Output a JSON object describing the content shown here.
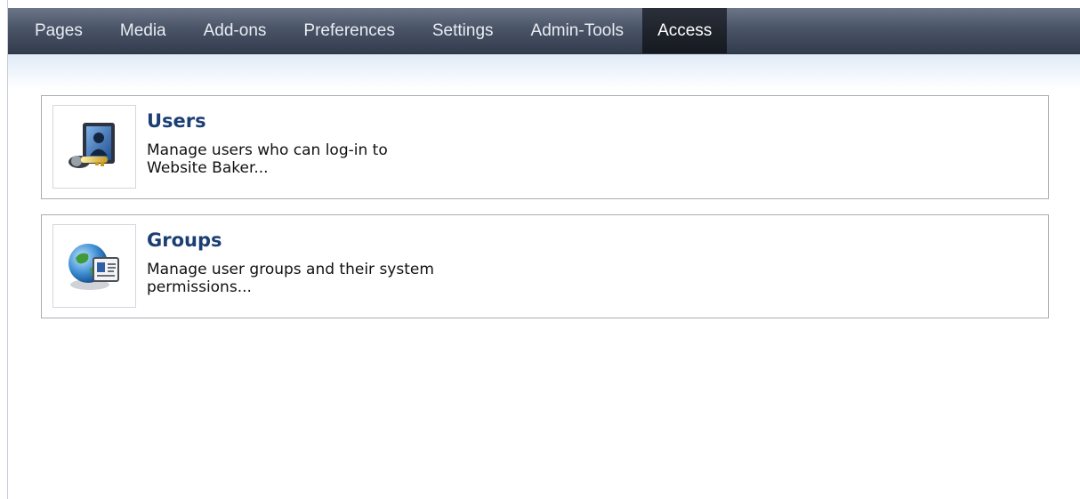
{
  "nav": {
    "items": [
      {
        "label": "Pages",
        "active": false
      },
      {
        "label": "Media",
        "active": false
      },
      {
        "label": "Add-ons",
        "active": false
      },
      {
        "label": "Preferences",
        "active": false
      },
      {
        "label": "Settings",
        "active": false
      },
      {
        "label": "Admin-Tools",
        "active": false
      },
      {
        "label": "Access",
        "active": true
      }
    ]
  },
  "sections": [
    {
      "title": "Users",
      "description_line1": "Manage users who can log-in to",
      "description_line2": "Website Baker...",
      "icon": "user-keys-icon"
    },
    {
      "title": "Groups",
      "description_line1": "Manage user groups and their system",
      "description_line2": "permissions...",
      "icon": "globe-id-card-icon"
    }
  ],
  "colors": {
    "title": "#1c3f73",
    "nav_bar": "#4a5467",
    "nav_active": "#1b1f27"
  }
}
